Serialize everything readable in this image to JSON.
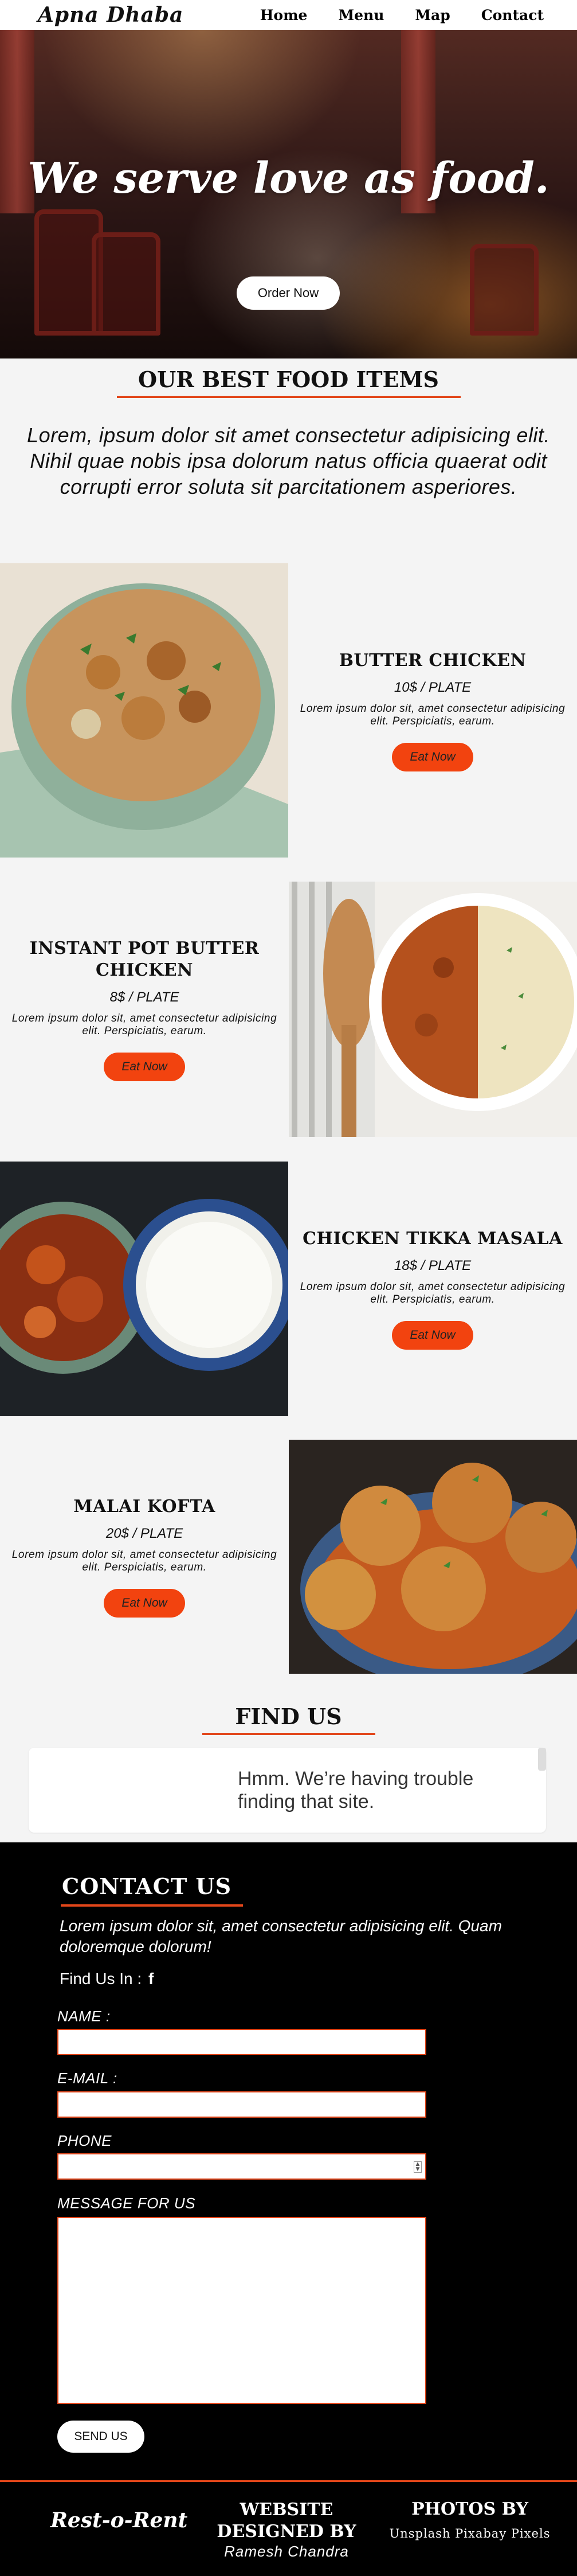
{
  "brand": "Apna Dhaba",
  "nav": [
    "Home",
    "Menu",
    "Map",
    "Contact"
  ],
  "hero": {
    "title": "We serve love as food.",
    "button": "Order Now"
  },
  "best": {
    "title": "OUR BEST FOOD ITEMS",
    "intro": "Lorem, ipsum dolor sit amet consectetur adipisicing elit. Nihil quae nobis ipsa dolorum natus officia quaerat odit corrupti error soluta sit parcitationem asperiores."
  },
  "foods": [
    {
      "name": "BUTTER CHICKEN",
      "price": "10$ / PLATE",
      "desc": "Lorem ipsum dolor sit, amet consectetur adipisicing elit. Perspiciatis, earum.",
      "button": "Eat Now"
    },
    {
      "name": "INSTANT POT BUTTER CHICKEN",
      "price": "8$ / PLATE",
      "desc": "Lorem ipsum dolor sit, amet consectetur adipisicing elit. Perspiciatis, earum.",
      "button": "Eat Now"
    },
    {
      "name": "CHICKEN TIKKA MASALA",
      "price": "18$ / PLATE",
      "desc": "Lorem ipsum dolor sit, amet consectetur adipisicing elit. Perspiciatis, earum.",
      "button": "Eat Now"
    },
    {
      "name": "MALAI KOFTA",
      "price": "20$ / PLATE",
      "desc": "Lorem ipsum dolor sit, amet consectetur adipisicing elit. Perspiciatis, earum.",
      "button": "Eat Now"
    }
  ],
  "find": {
    "title": "FIND US",
    "map_message": "Hmm. We’re having trouble finding that site."
  },
  "contact": {
    "title": "CONTACT US",
    "text": "Lorem ipsum dolor sit, amet consectetur adipisicing elit. Quam doloremque dolorum!",
    "find_us_in": "Find Us In :",
    "facebook_glyph": "f",
    "name_label": "NAME :",
    "email_label": "E-MAIL :",
    "phone_label": "PHONE",
    "message_label": "MESSAGE FOR US",
    "send": "SEND US"
  },
  "footer": {
    "logo": "Rest-o-Rent",
    "designed": "WEBSITE DESIGNED BY",
    "designer": "Ramesh Chandra",
    "photos": "PHOTOS BY",
    "credit": "Unsplash Pixabay Pixels"
  },
  "colors": {
    "accent": "#f2430f",
    "underline": "#e2461a",
    "contact_bg": "#000000"
  }
}
